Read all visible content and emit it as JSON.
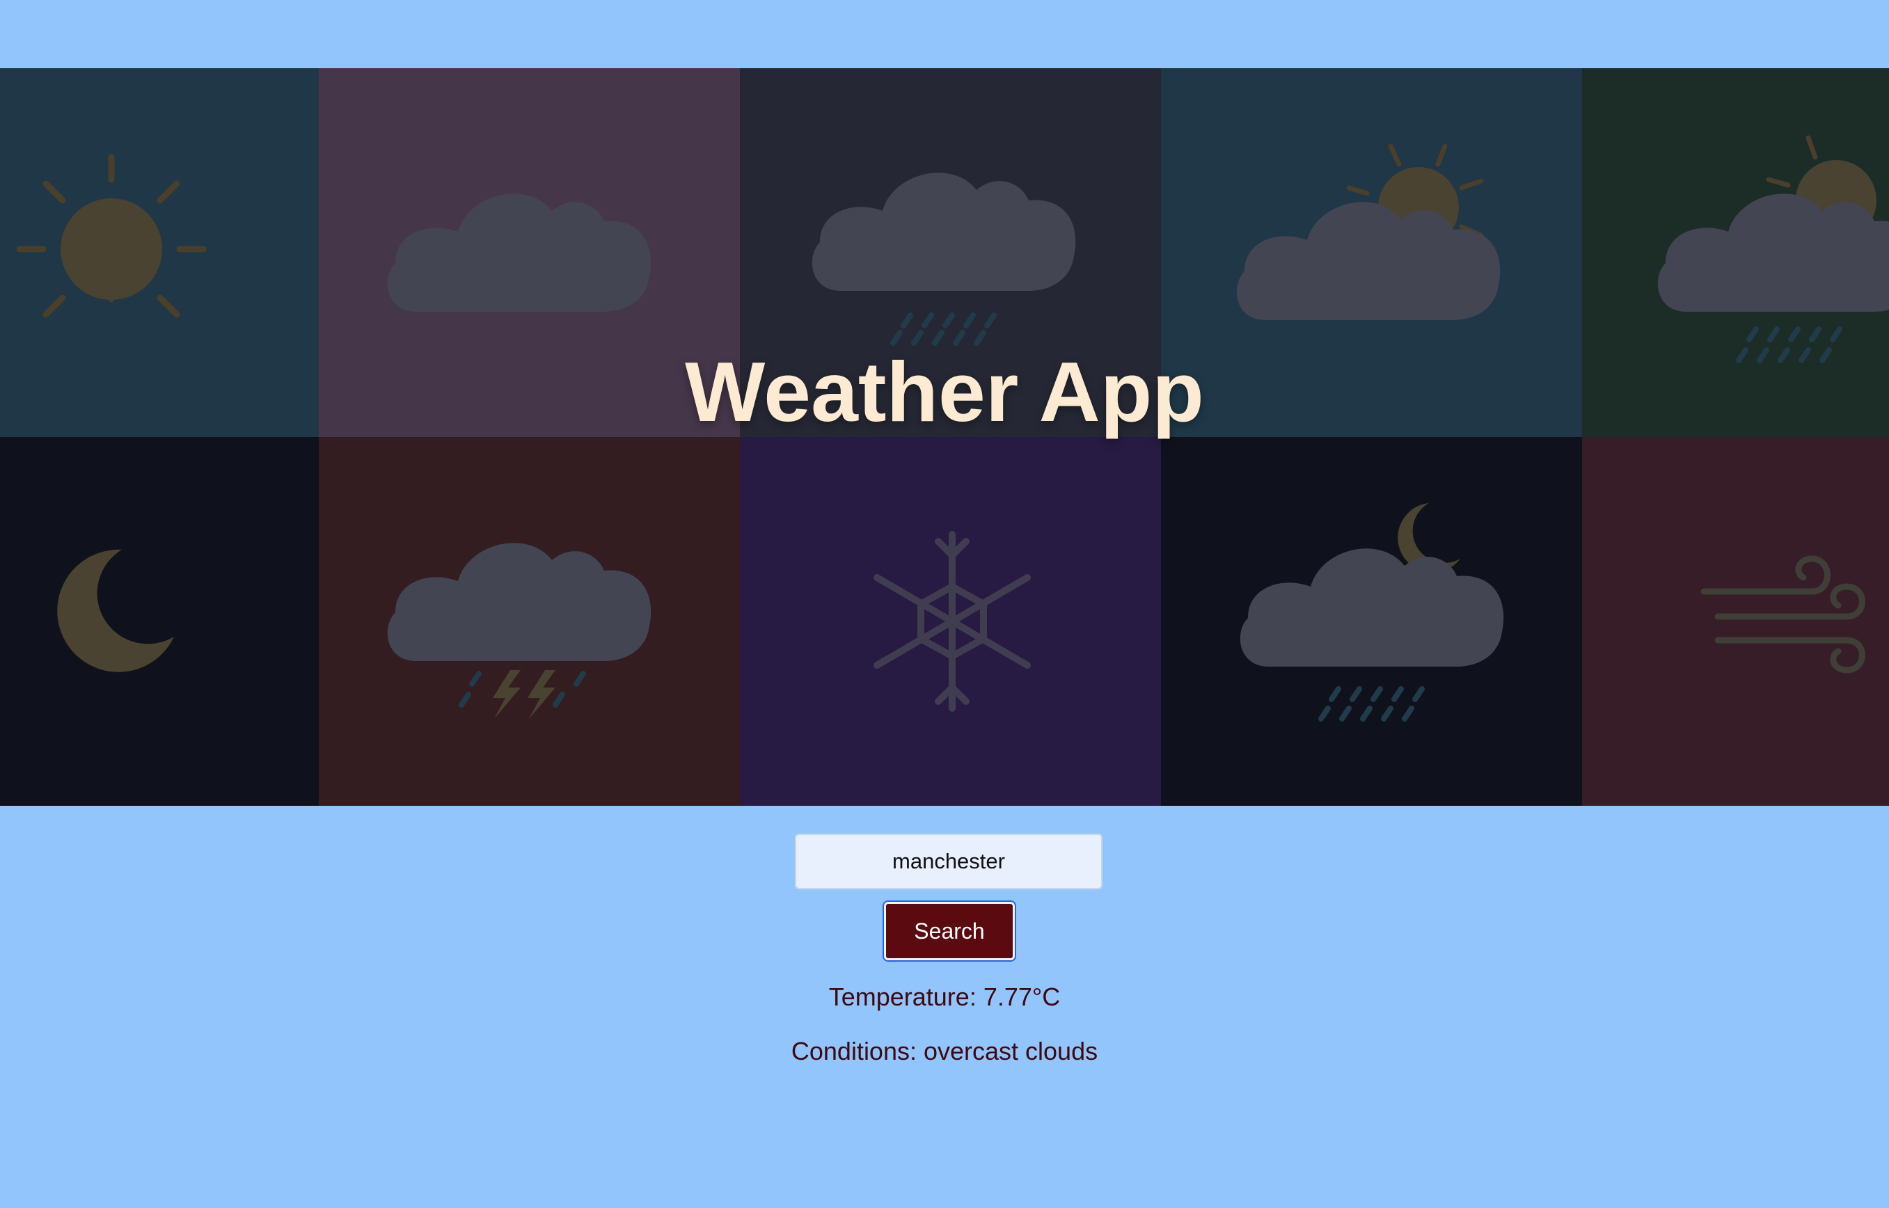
{
  "app": {
    "title": "Weather App"
  },
  "hero": {
    "tiles": [
      {
        "icon": "sun-icon",
        "bg": "#1f3747"
      },
      {
        "icon": "cloud-icon",
        "bg": "#45364a"
      },
      {
        "icon": "rain-cloud-icon",
        "bg": "#252834"
      },
      {
        "icon": "partly-cloudy-icon",
        "bg": "#1f3747"
      },
      {
        "icon": "partly-cloudy-rain-icon",
        "bg": "#1c2d28"
      },
      {
        "icon": "moon-icon",
        "bg": "#0f121d"
      },
      {
        "icon": "thunderstorm-icon",
        "bg": "#331d20"
      },
      {
        "icon": "snowflake-icon",
        "bg": "#271a43"
      },
      {
        "icon": "night-rain-icon",
        "bg": "#0f121d"
      },
      {
        "icon": "wind-icon",
        "bg": "#361d27"
      }
    ]
  },
  "search": {
    "value": "manchester",
    "button_label": "Search"
  },
  "result": {
    "temperature": "Temperature: 7.77°C",
    "conditions": "Conditions: overcast clouds"
  },
  "colors": {
    "page_bg": "#93c5fd",
    "title": "#fcead2",
    "button_bg": "#5b0b0f",
    "text": "#3d0a10"
  }
}
